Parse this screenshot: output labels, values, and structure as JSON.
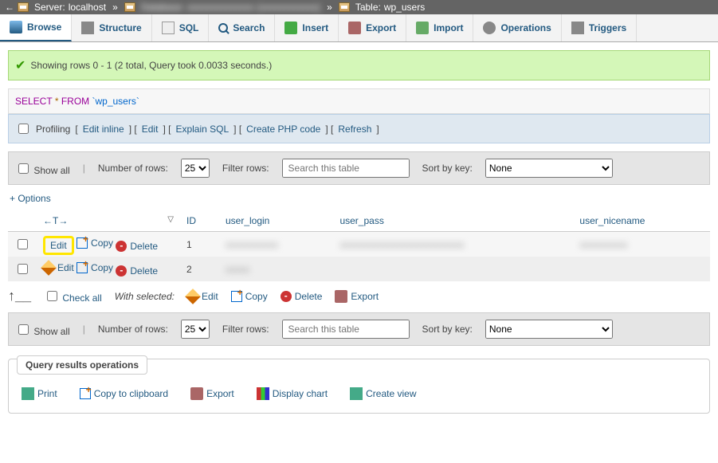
{
  "breadcrumb": {
    "server_label": "Server:",
    "server_value": "localhost",
    "table_label": "Table:",
    "table_value": "wp_users"
  },
  "tabs": [
    "Browse",
    "Structure",
    "SQL",
    "Search",
    "Insert",
    "Export",
    "Import",
    "Operations",
    "Triggers"
  ],
  "success_msg": "Showing rows 0 - 1 (2 total, Query took 0.0033 seconds.)",
  "sql": {
    "select": "SELECT",
    "star": "*",
    "from": "FROM",
    "table": "`wp_users`"
  },
  "prof": {
    "label": "Profiling",
    "links": [
      "Edit inline",
      "Edit",
      "Explain SQL",
      "Create PHP code",
      "Refresh"
    ]
  },
  "controls": {
    "show_all": "Show all",
    "num_rows": "Number of rows:",
    "rows_val": "25",
    "filter": "Filter rows:",
    "search_ph": "Search this table",
    "sort": "Sort by key:",
    "sort_val": "None"
  },
  "options_link": "+ Options",
  "nav_arrows": "←T→",
  "cols": [
    "ID",
    "user_login",
    "user_pass",
    "user_nicename"
  ],
  "row_actions": [
    "Edit",
    "Copy",
    "Delete"
  ],
  "rows": [
    {
      "id": "1"
    },
    {
      "id": "2"
    }
  ],
  "sel": {
    "check_all": "Check all",
    "with": "With selected:",
    "actions": [
      "Edit",
      "Copy",
      "Delete",
      "Export"
    ]
  },
  "panel": {
    "title": "Query results operations",
    "actions": [
      "Print",
      "Copy to clipboard",
      "Export",
      "Display chart",
      "Create view"
    ]
  }
}
